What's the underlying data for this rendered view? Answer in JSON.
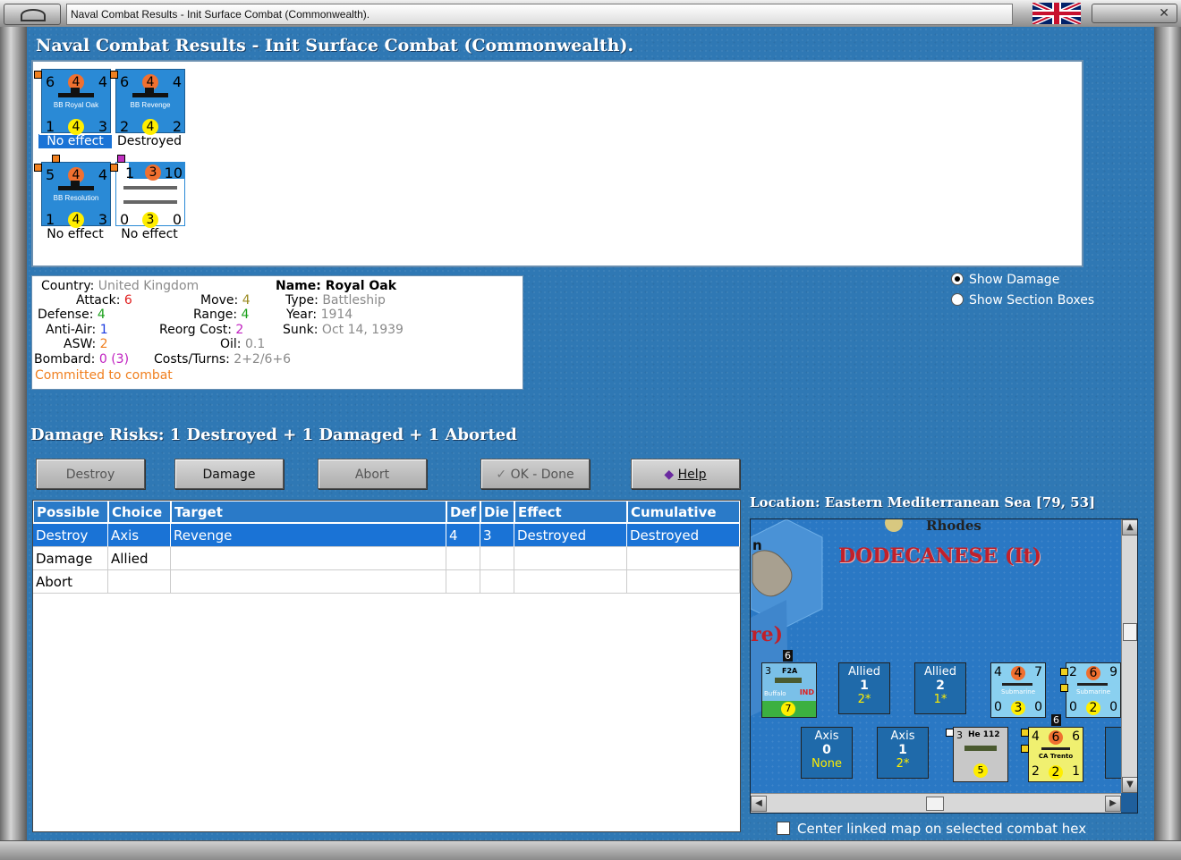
{
  "window": {
    "title": "Naval Combat Results - Init Surface Combat (Commonwealth)."
  },
  "header": {
    "title": "Naval Combat Results - Init Surface Combat (Commonwealth)."
  },
  "units": [
    {
      "name": "BB Royal Oak",
      "top": [
        "6",
        "4",
        "4"
      ],
      "bottom": [
        "1",
        "4",
        "3"
      ],
      "result": "No effect",
      "selected": true
    },
    {
      "name": "BB Revenge",
      "top": [
        "6",
        "4",
        "4"
      ],
      "bottom": [
        "2",
        "4",
        "2"
      ],
      "result": "Destroyed",
      "selected": false
    },
    {
      "name": "BB Resolution",
      "top": [
        "5",
        "4",
        "4"
      ],
      "bottom": [
        "1",
        "4",
        "3"
      ],
      "result": "No effect",
      "selected": false
    },
    {
      "name": "",
      "top": [
        "1",
        "3",
        "10"
      ],
      "bottom": [
        "0",
        "3",
        "0"
      ],
      "result": "No effect",
      "selected": false
    }
  ],
  "info": {
    "country_label": "Country:",
    "country": "United Kingdom",
    "attack_label": "Attack:",
    "attack": "6",
    "defense_label": "Defense:",
    "defense": "4",
    "antiair_label": "Anti-Air:",
    "antiair": "1",
    "asw_label": "ASW:",
    "asw": "2",
    "bombard_label": "Bombard:",
    "bombard": "0 (3)",
    "move_label": "Move:",
    "move": "4",
    "range_label": "Range:",
    "range": "4",
    "reorg_label": "Reorg Cost:",
    "reorg": "2",
    "oil_label": "Oil:",
    "oil": "0.1",
    "costs_label": "Costs/Turns:",
    "costs": "2+2/6+6",
    "name_label": "Name:",
    "name": "Royal Oak",
    "type_label": "Type:",
    "type": "Battleship",
    "year_label": "Year:",
    "year": "1914",
    "sunk_label": "Sunk:",
    "sunk": "Oct 14, 1939",
    "status": "Committed to combat"
  },
  "options": {
    "show_damage": "Show Damage",
    "show_sections": "Show Section Boxes"
  },
  "damage_risks": "Damage Risks:  1 Destroyed + 1 Damaged + 1 Aborted",
  "buttons": {
    "destroy": "Destroy",
    "damage": "Damage",
    "abort": "Abort",
    "ok": "OK - Done",
    "help": "Help"
  },
  "table": {
    "headers": [
      "Possible",
      "Choice",
      "Target",
      "Def",
      "Die",
      "Effect",
      "Cumulative"
    ],
    "rows": [
      [
        "Destroy",
        "Axis",
        "Revenge",
        "4",
        "3",
        "Destroyed",
        "Destroyed"
      ],
      [
        "Damage",
        "Allied",
        "",
        "",
        "",
        "",
        ""
      ],
      [
        "Abort",
        "",
        "",
        "",
        "",
        "",
        ""
      ]
    ]
  },
  "location": "Location:  Eastern Mediterranean Sea [79, 53]",
  "map": {
    "region": "DODECANESE (It)",
    "rhodes": "Rhodes",
    "re": "re)",
    "n": "n",
    "stack_count_1": "6",
    "stack_count_2": "6",
    "air_unit": {
      "top": "3",
      "type": "F2A",
      "name": "Buffalo",
      "nat": "IND",
      "val": "7"
    },
    "allied1": {
      "side": "Allied",
      "num": "1",
      "sub": "2*"
    },
    "allied2": {
      "side": "Allied",
      "num": "2",
      "sub": "1*"
    },
    "sub1": {
      "top": [
        "4",
        "4",
        "7"
      ],
      "name": "Submarine",
      "bottom": [
        "0",
        "3",
        "0"
      ]
    },
    "sub2": {
      "top": [
        "2",
        "6",
        "9"
      ],
      "name": "Submarine",
      "bottom": [
        "0",
        "2",
        "0"
      ]
    },
    "axis1": {
      "side": "Axis",
      "num": "0",
      "sub": "None"
    },
    "axis2": {
      "side": "Axis",
      "num": "1",
      "sub": "2*"
    },
    "he112": {
      "top": "3",
      "type": "He 112",
      "val": "5"
    },
    "ca_trento": {
      "top": [
        "4",
        "6",
        "6"
      ],
      "name": "CA Trento",
      "bottom": [
        "2",
        "2",
        "1"
      ]
    }
  },
  "center_map_label": "Center linked map on selected combat hex",
  "colors": {
    "panel_blue": "#2f78b4",
    "selection": "#1a73d6",
    "table_header": "#2a7ac8",
    "map_title": "#c0202a"
  }
}
